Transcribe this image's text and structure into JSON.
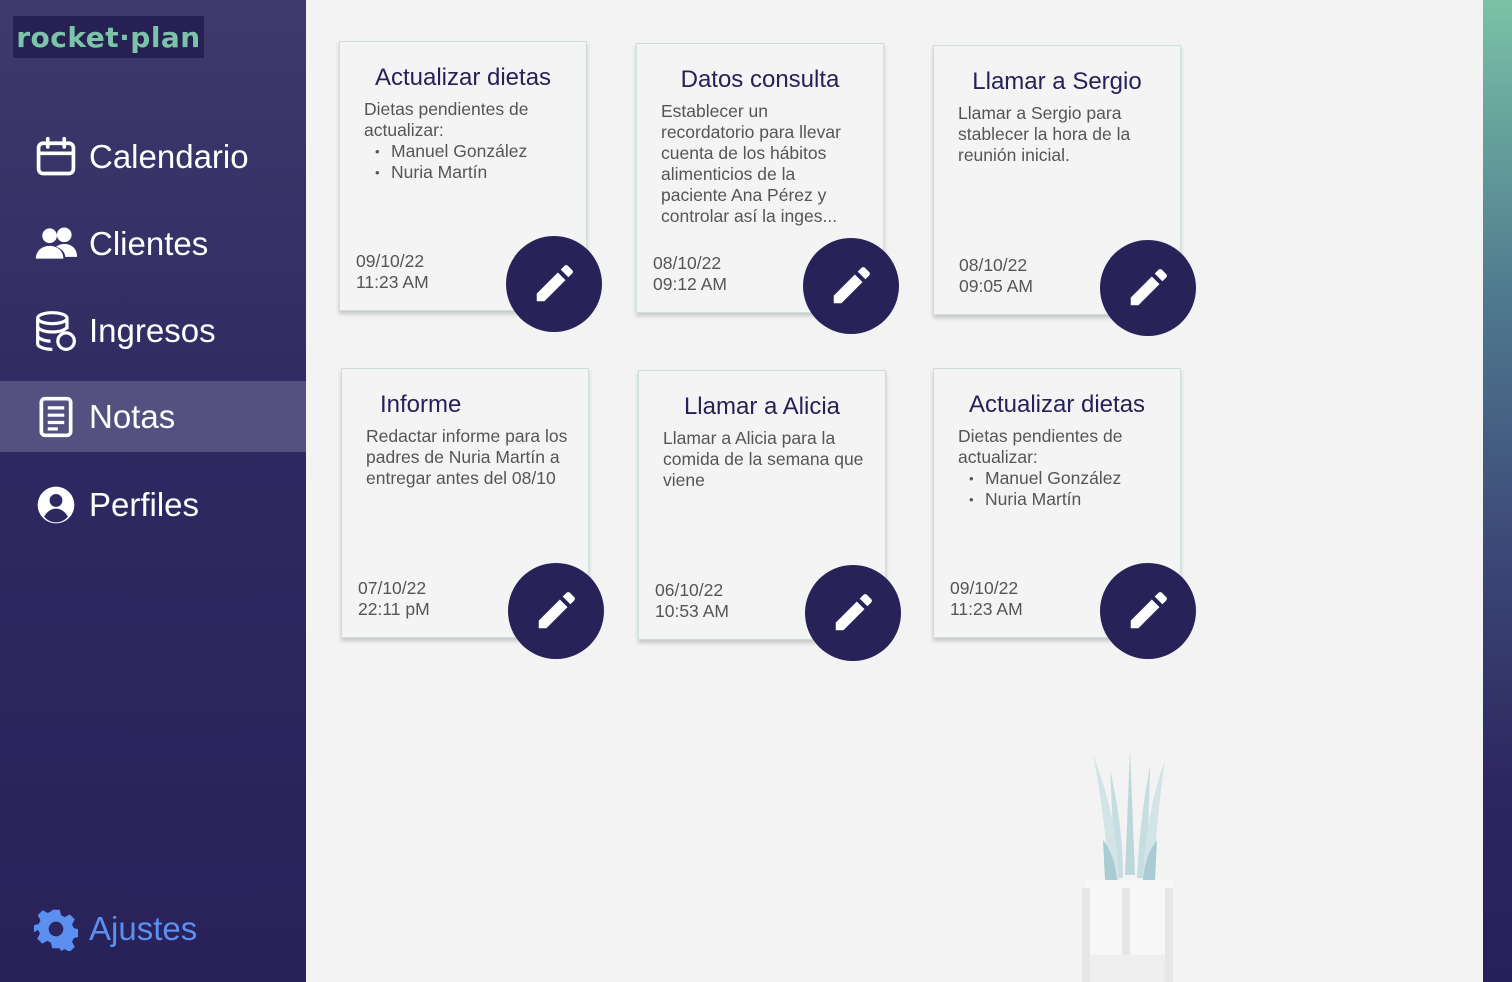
{
  "app": {
    "logo_text": "rocket·plan"
  },
  "sidebar": {
    "items": [
      {
        "label": "Calendario",
        "icon": "calendar-icon",
        "active": false
      },
      {
        "label": "Clientes",
        "icon": "users-icon",
        "active": false
      },
      {
        "label": "Ingresos",
        "icon": "coins-database-icon",
        "active": false
      },
      {
        "label": "Notas",
        "icon": "notes-icon",
        "active": true
      },
      {
        "label": "Perfiles",
        "icon": "user-circle-icon",
        "active": false
      }
    ],
    "settings": {
      "label": "Ajustes",
      "icon": "gear-icon",
      "color": "#5b8ff0"
    }
  },
  "colors": {
    "sidebar": "#2f2962",
    "accent": "#272258",
    "active_item": "#545080",
    "logo_green": "#7cc4a8"
  },
  "notes": [
    {
      "title": "Actualizar dietas",
      "body": "Dietas pendientes de actualizar:",
      "bullets": [
        "Manuel González",
        "Nuria Martín"
      ],
      "date": "09/10/22",
      "time": "11:23 AM"
    },
    {
      "title": "Datos consulta",
      "body": "Establecer un recordatorio para llevar cuenta de los hábitos alimenticios de la paciente Ana Pérez y controlar así la inges...",
      "bullets": [],
      "date": "08/10/22",
      "time": "09:12 AM"
    },
    {
      "title": "Llamar a Sergio",
      "body": "Llamar a Sergio para stablecer la hora de la reunión inicial.",
      "bullets": [],
      "date": "08/10/22",
      "time": "09:05 AM"
    },
    {
      "title": "Informe",
      "body": "Redactar informe para los padres de Nuria Martín a entregar antes del 08/10",
      "bullets": [],
      "date": "07/10/22",
      "time": "22:11 pM"
    },
    {
      "title": "Llamar a Alicia",
      "body": "Llamar a Alicia para la comida de la semana que viene",
      "bullets": [],
      "date": "06/10/22",
      "time": "10:53 AM"
    },
    {
      "title": "Actualizar dietas",
      "body": "Dietas pendientes de actualizar:",
      "bullets": [
        "Manuel González",
        "Nuria Martín"
      ],
      "date": "09/10/22",
      "time": "11:23 AM"
    }
  ]
}
